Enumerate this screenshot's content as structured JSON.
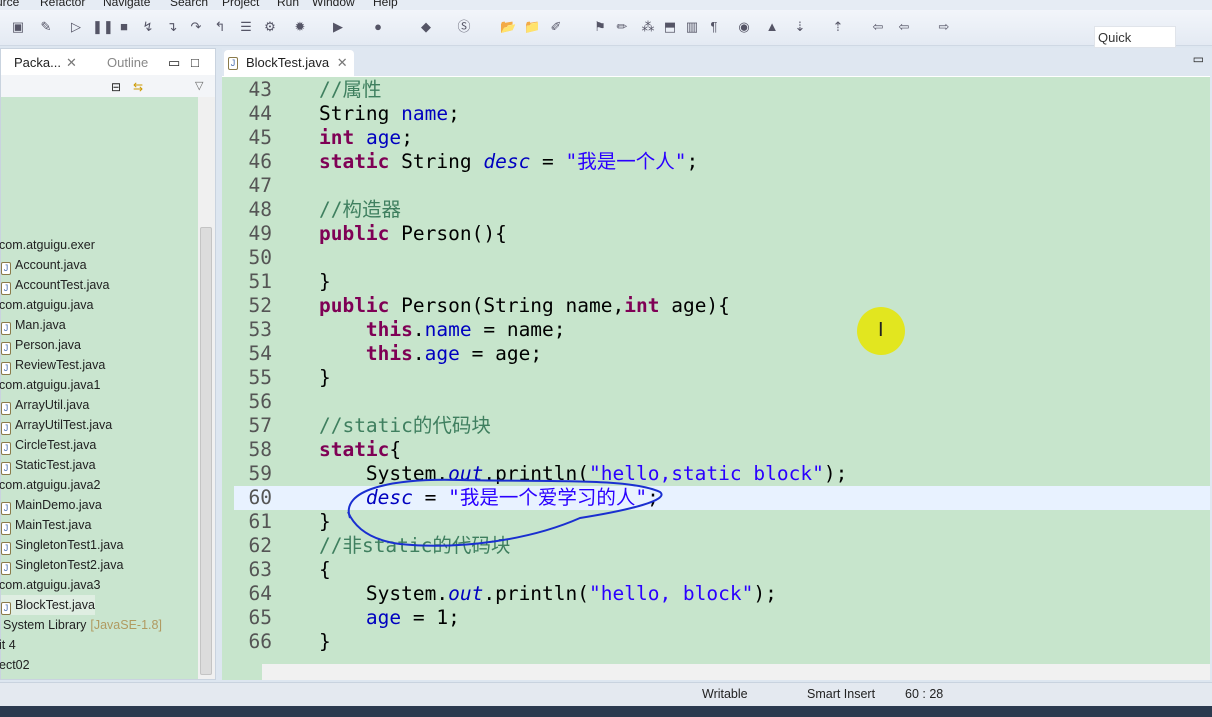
{
  "menu": [
    "urce",
    "Refactor",
    "Navigate",
    "Search",
    "Project",
    "Run",
    "Window",
    "Help"
  ],
  "quick_access": "Quick Access",
  "left_panel": {
    "tabs": [
      "Packa...",
      "Outline"
    ],
    "tree": [
      {
        "label": "com.atguigu.exer",
        "type": "package"
      },
      {
        "label": "Account.java",
        "type": "file"
      },
      {
        "label": "AccountTest.java",
        "type": "file"
      },
      {
        "label": "com.atguigu.java",
        "type": "package"
      },
      {
        "label": "Man.java",
        "type": "file"
      },
      {
        "label": "Person.java",
        "type": "file"
      },
      {
        "label": "ReviewTest.java",
        "type": "file"
      },
      {
        "label": "com.atguigu.java1",
        "type": "package"
      },
      {
        "label": "ArrayUtil.java",
        "type": "file"
      },
      {
        "label": "ArrayUtilTest.java",
        "type": "file"
      },
      {
        "label": "CircleTest.java",
        "type": "file"
      },
      {
        "label": "StaticTest.java",
        "type": "file"
      },
      {
        "label": "com.atguigu.java2",
        "type": "package"
      },
      {
        "label": "MainDemo.java",
        "type": "file"
      },
      {
        "label": "MainTest.java",
        "type": "file"
      },
      {
        "label": "SingletonTest1.java",
        "type": "file"
      },
      {
        "label": "SingletonTest2.java",
        "type": "file"
      },
      {
        "label": "com.atguigu.java3",
        "type": "package"
      },
      {
        "label": "BlockTest.java",
        "type": "file",
        "selected": true
      },
      {
        "label": "System Library",
        "suffix": "[JavaSE-1.8]",
        "type": "lib"
      },
      {
        "label": "it 4",
        "type": "other"
      },
      {
        "label": "ect02",
        "type": "other"
      }
    ]
  },
  "editor": {
    "tab": "BlockTest.java",
    "current_line": 60,
    "lines": [
      {
        "n": "43",
        "t": [
          [
            "p",
            "    "
          ],
          [
            "c",
            "//属性"
          ]
        ]
      },
      {
        "n": "44",
        "t": [
          [
            "p",
            "    String "
          ],
          [
            "f",
            "name"
          ],
          [
            "p",
            ";"
          ]
        ]
      },
      {
        "n": "45",
        "t": [
          [
            "p",
            "    "
          ],
          [
            "k",
            "int"
          ],
          [
            "p",
            " "
          ],
          [
            "f",
            "age"
          ],
          [
            "p",
            ";"
          ]
        ]
      },
      {
        "n": "46",
        "t": [
          [
            "p",
            "    "
          ],
          [
            "k",
            "static"
          ],
          [
            "p",
            " String "
          ],
          [
            "fi",
            "desc"
          ],
          [
            "p",
            " = "
          ],
          [
            "s",
            "\"我是一个人\""
          ],
          [
            "p",
            ";"
          ]
        ]
      },
      {
        "n": "47",
        "t": []
      },
      {
        "n": "48",
        "t": [
          [
            "p",
            "    "
          ],
          [
            "c",
            "//构造器"
          ]
        ]
      },
      {
        "n": "49",
        "t": [
          [
            "p",
            "    "
          ],
          [
            "k",
            "public"
          ],
          [
            "p",
            " Person(){"
          ]
        ]
      },
      {
        "n": "50",
        "t": []
      },
      {
        "n": "51",
        "t": [
          [
            "p",
            "    }"
          ]
        ]
      },
      {
        "n": "52",
        "t": [
          [
            "p",
            "    "
          ],
          [
            "k",
            "public"
          ],
          [
            "p",
            " Person(String name,"
          ],
          [
            "k",
            "int"
          ],
          [
            "p",
            " age){"
          ]
        ]
      },
      {
        "n": "53",
        "t": [
          [
            "p",
            "        "
          ],
          [
            "k",
            "this"
          ],
          [
            "p",
            "."
          ],
          [
            "f",
            "name"
          ],
          [
            "p",
            " = name;"
          ]
        ]
      },
      {
        "n": "54",
        "t": [
          [
            "p",
            "        "
          ],
          [
            "k",
            "this"
          ],
          [
            "p",
            "."
          ],
          [
            "f",
            "age"
          ],
          [
            "p",
            " = age;"
          ]
        ]
      },
      {
        "n": "55",
        "t": [
          [
            "p",
            "    }"
          ]
        ]
      },
      {
        "n": "56",
        "t": []
      },
      {
        "n": "57",
        "t": [
          [
            "p",
            "    "
          ],
          [
            "c",
            "//static的代码块"
          ]
        ]
      },
      {
        "n": "58",
        "t": [
          [
            "p",
            "    "
          ],
          [
            "k",
            "static"
          ],
          [
            "p",
            "{"
          ]
        ]
      },
      {
        "n": "59",
        "t": [
          [
            "p",
            "        System."
          ],
          [
            "fi",
            "out"
          ],
          [
            "p",
            ".println("
          ],
          [
            "s",
            "\"hello,static block\""
          ],
          [
            "p",
            ");"
          ]
        ]
      },
      {
        "n": "60",
        "t": [
          [
            "p",
            "        "
          ],
          [
            "fi",
            "desc"
          ],
          [
            "p",
            " = "
          ],
          [
            "s",
            "\"我是一个爱学习的人\""
          ],
          [
            "p",
            ";"
          ]
        ]
      },
      {
        "n": "61",
        "t": [
          [
            "p",
            "    }"
          ]
        ]
      },
      {
        "n": "62",
        "t": [
          [
            "p",
            "    "
          ],
          [
            "c",
            "//非static的代码块"
          ]
        ]
      },
      {
        "n": "63",
        "t": [
          [
            "p",
            "    {"
          ]
        ]
      },
      {
        "n": "64",
        "t": [
          [
            "p",
            "        System."
          ],
          [
            "fi",
            "out"
          ],
          [
            "p",
            ".println("
          ],
          [
            "s",
            "\"hello, block\""
          ],
          [
            "p",
            ");"
          ]
        ]
      },
      {
        "n": "65",
        "t": [
          [
            "p",
            "        "
          ],
          [
            "f",
            "age"
          ],
          [
            "p",
            " = 1;"
          ]
        ]
      },
      {
        "n": "66",
        "t": [
          [
            "p",
            "    }"
          ]
        ]
      }
    ]
  },
  "status": {
    "writable": "Writable",
    "insert_mode": "Smart Insert",
    "position": "60 : 28"
  },
  "colors": {
    "editor_bg": "#c7e5cc",
    "keyword": "#7f0055",
    "field": "#0000c0",
    "string": "#2a00ff",
    "comment": "#3f7f5f",
    "annotation_ink": "#1a2fd0"
  }
}
